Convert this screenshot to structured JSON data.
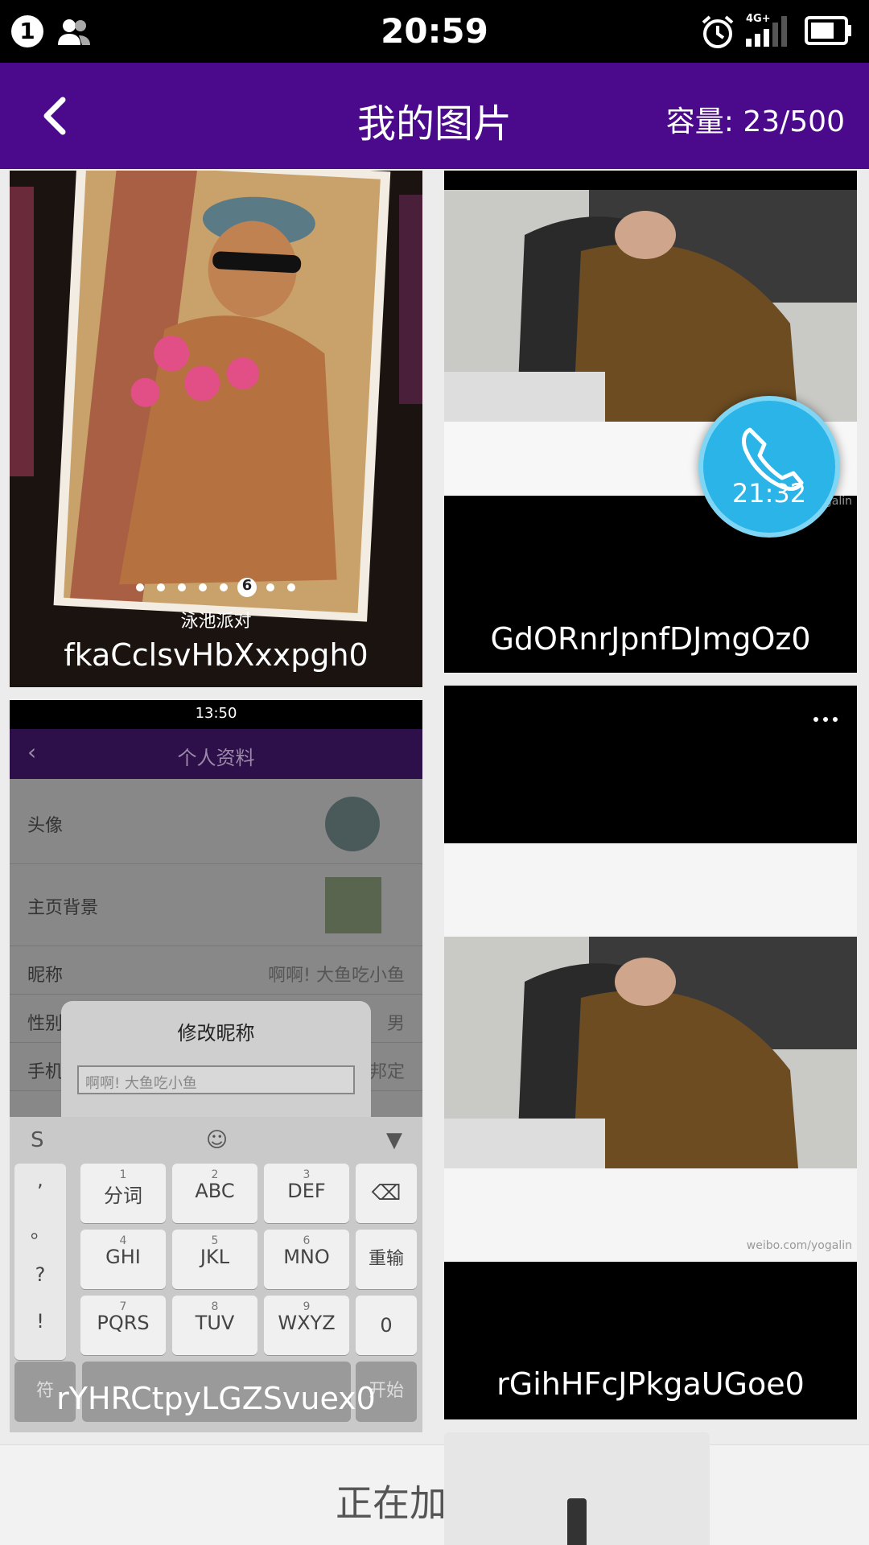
{
  "status_bar": {
    "notification_count": "1",
    "time": "20:59",
    "network": "4G+"
  },
  "app_bar": {
    "title": "我的图片",
    "capacity": "容量: 23/500"
  },
  "tiles": [
    {
      "caption": "fkaCclsvHbXxxpgh0",
      "subtitle": "泳池派对",
      "carousel_active": "6"
    },
    {
      "caption": "GdORnrJpnfDJmgOz0",
      "watermark": "yogalin"
    },
    {
      "caption": "rYHRCtpyLGZSvuex0"
    },
    {
      "caption": "rGihHFcJPkgaUGoe0",
      "watermark": "weibo.com/yogalin"
    }
  ],
  "call_bubble": {
    "time": "21:32"
  },
  "inner_screenshot": {
    "time": "13:50",
    "title": "个人资料",
    "rows": [
      {
        "label": "头像"
      },
      {
        "label": "主页背景"
      },
      {
        "label": "昵称",
        "value": "啊啊! 大鱼吃小鱼"
      },
      {
        "label": "性别",
        "value": "男"
      },
      {
        "label": "手机",
        "value": "邦定"
      }
    ],
    "dialog_title": "修改昵称",
    "dialog_input": "啊啊! 大鱼吃小鱼",
    "keys": [
      {
        "num": "1",
        "label": "分词"
      },
      {
        "num": "2",
        "label": "ABC"
      },
      {
        "num": "3",
        "label": "DEF"
      },
      {
        "num": "4",
        "label": "GHI"
      },
      {
        "num": "5",
        "label": "JKL"
      },
      {
        "num": "6",
        "label": "MNO"
      },
      {
        "num": "7",
        "label": "PQRS"
      },
      {
        "num": "8",
        "label": "TUV"
      },
      {
        "num": "9",
        "label": "WXYZ"
      }
    ],
    "side_keys": [
      ",",
      "。",
      "?",
      "!"
    ],
    "right_keys": [
      "重输",
      "0"
    ],
    "bottom_left": "符",
    "bottom_right": "开始"
  },
  "loading_text": "正在加"
}
